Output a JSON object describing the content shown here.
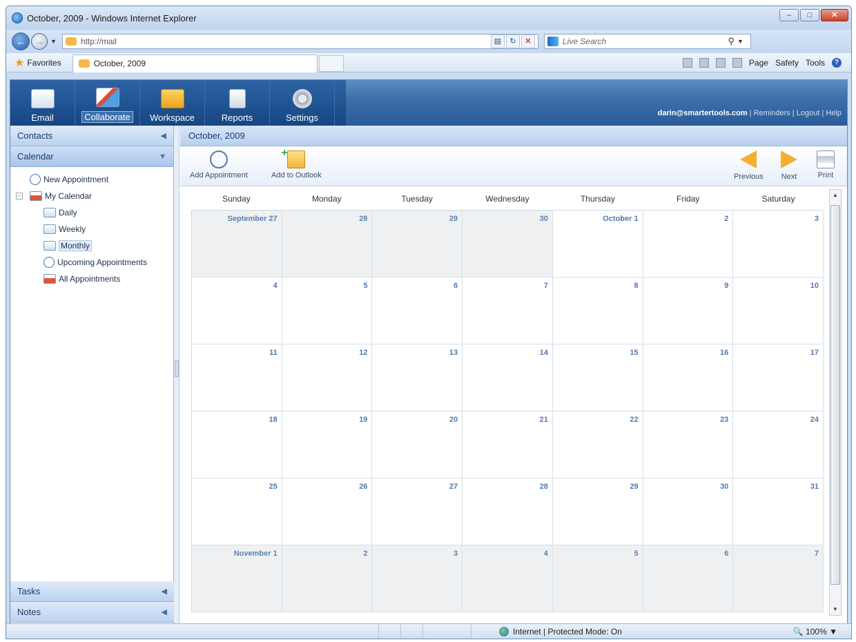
{
  "browser": {
    "window_title": "October, 2009 - Windows Internet Explorer",
    "address": "http://mail",
    "search_placeholder": "Live Search",
    "favorites_label": "Favorites",
    "tab_title": "October, 2009",
    "commands": {
      "page": "Page",
      "safety": "Safety",
      "tools": "Tools"
    },
    "status": "Internet | Protected Mode: On",
    "zoom": "100%"
  },
  "app": {
    "modules": [
      {
        "label": "Email",
        "icon": "email-icon"
      },
      {
        "label": "Collaborate",
        "icon": "collaborate-icon",
        "active": true
      },
      {
        "label": "Workspace",
        "icon": "folder-icon"
      },
      {
        "label": "Reports",
        "icon": "reports-icon"
      },
      {
        "label": "Settings",
        "icon": "gear-icon"
      }
    ],
    "user_email": "darin@smartertools.com",
    "links": {
      "reminders": "Reminders",
      "logout": "Logout",
      "help": "Help"
    }
  },
  "sidebar": {
    "contacts": "Contacts",
    "calendar": "Calendar",
    "tasks": "Tasks",
    "notes": "Notes",
    "tree": {
      "new_appointment": "New Appointment",
      "my_calendar": "My Calendar",
      "daily": "Daily",
      "weekly": "Weekly",
      "monthly": "Monthly",
      "upcoming": "Upcoming Appointments",
      "all": "All Appointments"
    }
  },
  "main": {
    "title": "October, 2009",
    "toolbar": {
      "add_appointment": "Add Appointment",
      "add_to_outlook": "Add to Outlook",
      "previous": "Previous",
      "next": "Next",
      "print": "Print"
    },
    "weekdays": [
      "Sunday",
      "Monday",
      "Tuesday",
      "Wednesday",
      "Thursday",
      "Friday",
      "Saturday"
    ],
    "weeks": [
      [
        "September 27",
        "28",
        "29",
        "30",
        "October 1",
        "2",
        "3"
      ],
      [
        "4",
        "5",
        "6",
        "7",
        "8",
        "9",
        "10"
      ],
      [
        "11",
        "12",
        "13",
        "14",
        "15",
        "16",
        "17"
      ],
      [
        "18",
        "19",
        "20",
        "21",
        "22",
        "23",
        "24"
      ],
      [
        "25",
        "26",
        "27",
        "28",
        "29",
        "30",
        "31"
      ],
      [
        "November 1",
        "2",
        "3",
        "4",
        "5",
        "6",
        "7"
      ]
    ],
    "other_month_mask": [
      [
        true,
        true,
        true,
        true,
        false,
        false,
        false
      ],
      [
        false,
        false,
        false,
        false,
        false,
        false,
        false
      ],
      [
        false,
        false,
        false,
        false,
        false,
        false,
        false
      ],
      [
        false,
        false,
        false,
        false,
        false,
        false,
        false
      ],
      [
        false,
        false,
        false,
        false,
        false,
        false,
        false
      ],
      [
        true,
        true,
        true,
        true,
        true,
        true,
        true
      ]
    ]
  }
}
